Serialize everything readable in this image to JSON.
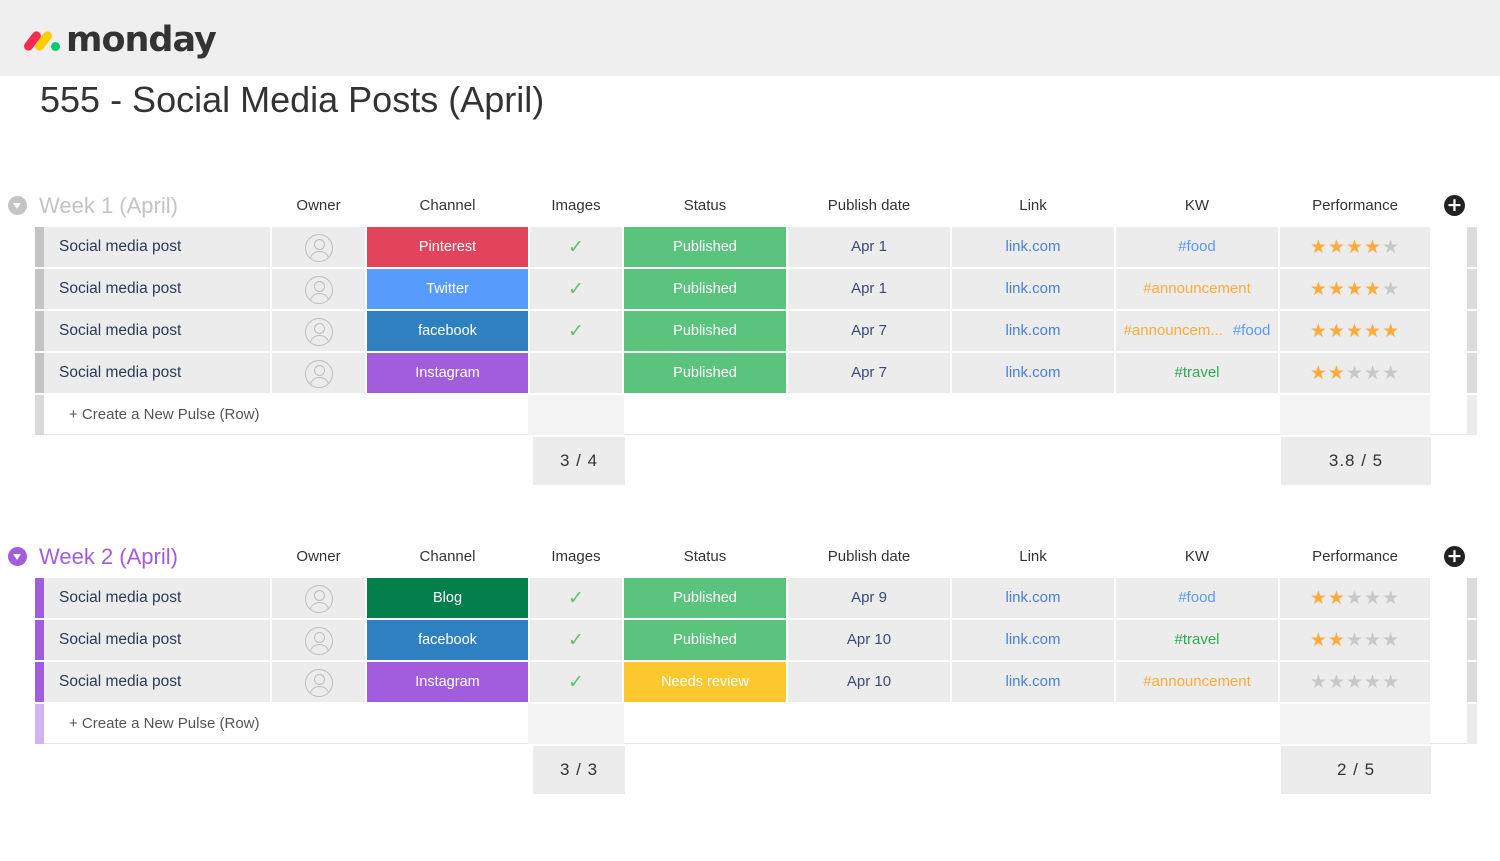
{
  "app": {
    "logo_text": "monday"
  },
  "board": {
    "title": "555 - Social Media Posts (April)"
  },
  "colors": {
    "week1_accent": "#c4c4c4",
    "week2_accent": "#a25ddc",
    "pinterest": "#e2445c",
    "twitter": "#579bfc",
    "facebook": "#2f80c0",
    "instagram": "#a25ddc",
    "blog": "#037f4c",
    "published": "#5ac47d",
    "needs_review": "#fdc82f",
    "kw_food": "#579bfc",
    "kw_announcement": "#fdab3d",
    "kw_travel": "#33a852"
  },
  "columns": [
    "Owner",
    "Channel",
    "Images",
    "Status",
    "Publish date",
    "Link",
    "KW",
    "Performance"
  ],
  "groups": [
    {
      "title": "Week 1 (April)",
      "rows": [
        {
          "name": "Social media post",
          "channel": "Pinterest",
          "images": true,
          "status": "Published",
          "date": "Apr 1",
          "link": "link.com",
          "kw": [
            {
              "text": "#food",
              "kind": "food"
            }
          ],
          "rating": 4
        },
        {
          "name": "Social media post",
          "channel": "Twitter",
          "images": true,
          "status": "Published",
          "date": "Apr 1",
          "link": "link.com",
          "kw": [
            {
              "text": "#announcement",
              "kind": "announcement"
            }
          ],
          "rating": 4
        },
        {
          "name": "Social media post",
          "channel": "facebook",
          "images": true,
          "status": "Published",
          "date": "Apr 7",
          "link": "link.com",
          "kw": [
            {
              "text": "#announcem...",
              "kind": "announcement"
            },
            {
              "text": "#food",
              "kind": "food"
            }
          ],
          "rating": 5
        },
        {
          "name": "Social media post",
          "channel": "Instagram",
          "images": false,
          "status": "Published",
          "date": "Apr 7",
          "link": "link.com",
          "kw": [
            {
              "text": "#travel",
              "kind": "travel"
            }
          ],
          "rating": 2
        }
      ],
      "new_row_label": "+ Create a New Pulse (Row)",
      "images_summary": "3 / 4",
      "performance_summary": "3.8 / 5"
    },
    {
      "title": "Week 2 (April)",
      "rows": [
        {
          "name": "Social media post",
          "channel": "Blog",
          "images": true,
          "status": "Published",
          "date": "Apr 9",
          "link": "link.com",
          "kw": [
            {
              "text": "#food",
              "kind": "food"
            }
          ],
          "rating": 2
        },
        {
          "name": "Social media post",
          "channel": "facebook",
          "images": true,
          "status": "Published",
          "date": "Apr 10",
          "link": "link.com",
          "kw": [
            {
              "text": "#travel",
              "kind": "travel"
            }
          ],
          "rating": 2
        },
        {
          "name": "Social media post",
          "channel": "Instagram",
          "images": true,
          "status": "Needs review",
          "date": "Apr 10",
          "link": "link.com",
          "kw": [
            {
              "text": "#announcement",
              "kind": "announcement"
            }
          ],
          "rating": 0
        }
      ],
      "new_row_label": "+ Create a New Pulse (Row)",
      "images_summary": "3 / 3",
      "performance_summary": "2 / 5"
    }
  ],
  "icons": {
    "collapse": "chevron-down-icon",
    "add_column": "plus-circle-icon",
    "owner": "person-icon",
    "image_check": "check-icon",
    "performance": "star-icon"
  }
}
